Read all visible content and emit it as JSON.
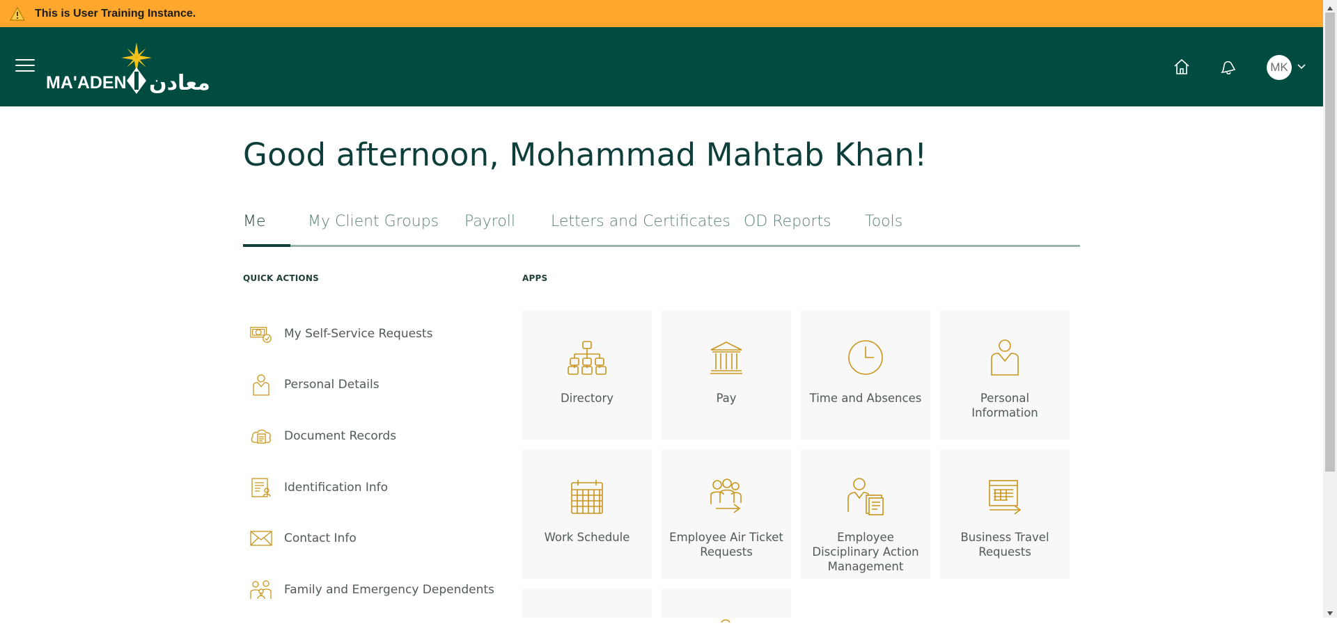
{
  "banner": {
    "text": "This is User Training Instance.",
    "icon": "warning-icon",
    "color": "#fda82c"
  },
  "header": {
    "brand_color": "#014c40",
    "logo_text": "MA'ADEN",
    "logo_arabic": "معادن",
    "avatar_initials": "MK",
    "icons": [
      "menu-icon",
      "home-icon",
      "notifications-bell-icon",
      "chevron-down-icon"
    ]
  },
  "greeting": "Good afternoon, Mohammad Mahtab Khan!",
  "tabs": [
    {
      "label": "Me",
      "active": true
    },
    {
      "label": "My Client Groups"
    },
    {
      "label": "Payroll"
    },
    {
      "label": "Letters and Certificates"
    },
    {
      "label": "OD Reports"
    },
    {
      "label": "Tools"
    }
  ],
  "quick_actions": {
    "title": "QUICK ACTIONS",
    "items": [
      {
        "label": "My Self-Service Requests",
        "icon": "self-service-requests-icon"
      },
      {
        "label": "Personal Details",
        "icon": "personal-details-icon"
      },
      {
        "label": "Document Records",
        "icon": "document-records-icon"
      },
      {
        "label": "Identification Info",
        "icon": "identification-info-icon"
      },
      {
        "label": "Contact Info",
        "icon": "envelope-icon"
      },
      {
        "label": "Family and Emergency Dependents",
        "icon": "family-icon"
      }
    ]
  },
  "apps": {
    "title": "APPS",
    "accent": "#c9941a",
    "items": [
      {
        "label": "Directory",
        "icon": "org-chart-icon"
      },
      {
        "label": "Pay",
        "icon": "bank-icon"
      },
      {
        "label": "Time and Absences",
        "icon": "clock-icon"
      },
      {
        "label": "Personal Information",
        "icon": "person-icon"
      },
      {
        "label": "Work Schedule",
        "icon": "calendar-icon"
      },
      {
        "label": "Employee Air Ticket Requests",
        "icon": "group-arrow-icon"
      },
      {
        "label": "Employee Disciplinary Action Management",
        "icon": "person-document-icon"
      },
      {
        "label": "Business Travel Requests",
        "icon": "report-arrow-icon"
      }
    ]
  }
}
